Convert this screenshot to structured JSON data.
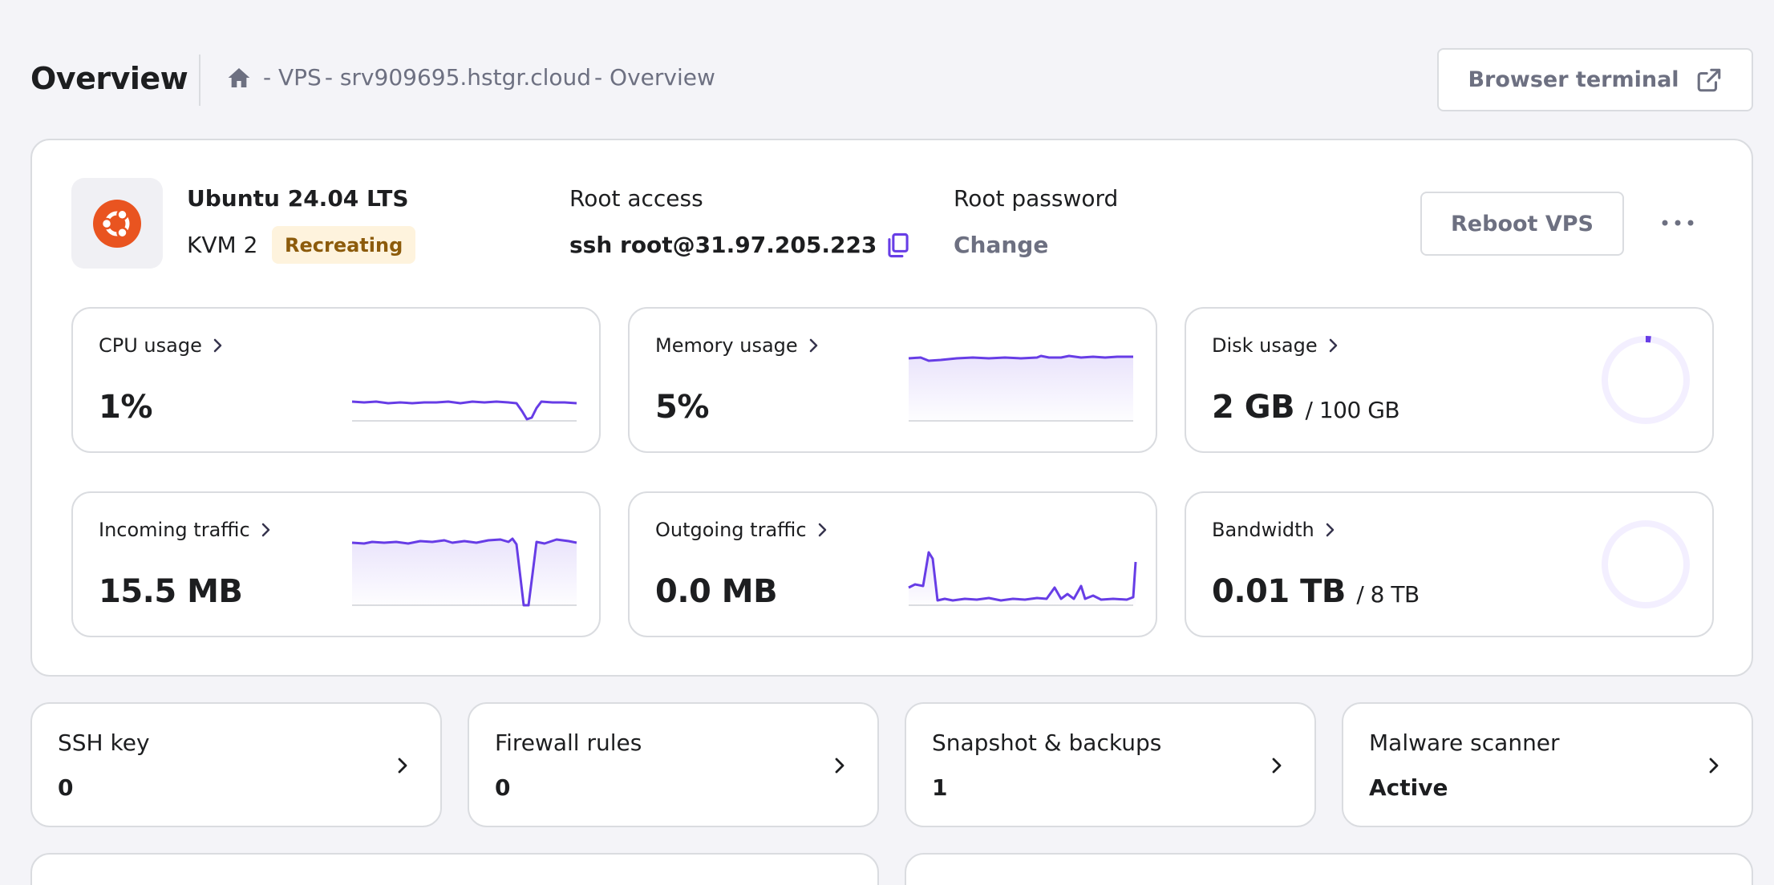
{
  "header": {
    "title": "Overview",
    "breadcrumb": [
      "- VPS",
      "- srv909695.hstgr.cloud",
      "- Overview"
    ],
    "terminal_button": "Browser terminal"
  },
  "server": {
    "os": "Ubuntu 24.04 LTS",
    "plan": "KVM 2",
    "status": "Recreating",
    "root_access_label": "Root access",
    "ssh_command": "ssh root@31.97.205.223",
    "root_password_label": "Root password",
    "change_label": "Change",
    "reboot_button": "Reboot VPS"
  },
  "metrics": {
    "cpu": {
      "label": "CPU usage",
      "value": "1%"
    },
    "memory": {
      "label": "Memory usage",
      "value": "5%"
    },
    "disk": {
      "label": "Disk usage",
      "value": "2 GB",
      "sub": "/ 100 GB",
      "used_fraction": 0.02
    },
    "incoming": {
      "label": "Incoming traffic",
      "value": "15.5 MB"
    },
    "outgoing": {
      "label": "Outgoing traffic",
      "value": "0.0 MB"
    },
    "bandwidth": {
      "label": "Bandwidth",
      "value": "0.01 TB",
      "sub": "/ 8 TB",
      "used_fraction": 0.00125
    }
  },
  "tiles": [
    {
      "label": "SSH key",
      "value": "0"
    },
    {
      "label": "Firewall rules",
      "value": "0"
    },
    {
      "label": "Snapshot & backups",
      "value": "1"
    },
    {
      "label": "Malware scanner",
      "value": "Active"
    }
  ],
  "colors": {
    "accent": "#673de6",
    "ubuntu": "#e95420",
    "badge_bg": "#fef3dd",
    "badge_text": "#8c5b0b"
  },
  "icons": [
    "home-icon",
    "external-link-icon",
    "ubuntu-logo-icon",
    "copy-icon",
    "more-icon",
    "chevron-right-icon"
  ]
}
